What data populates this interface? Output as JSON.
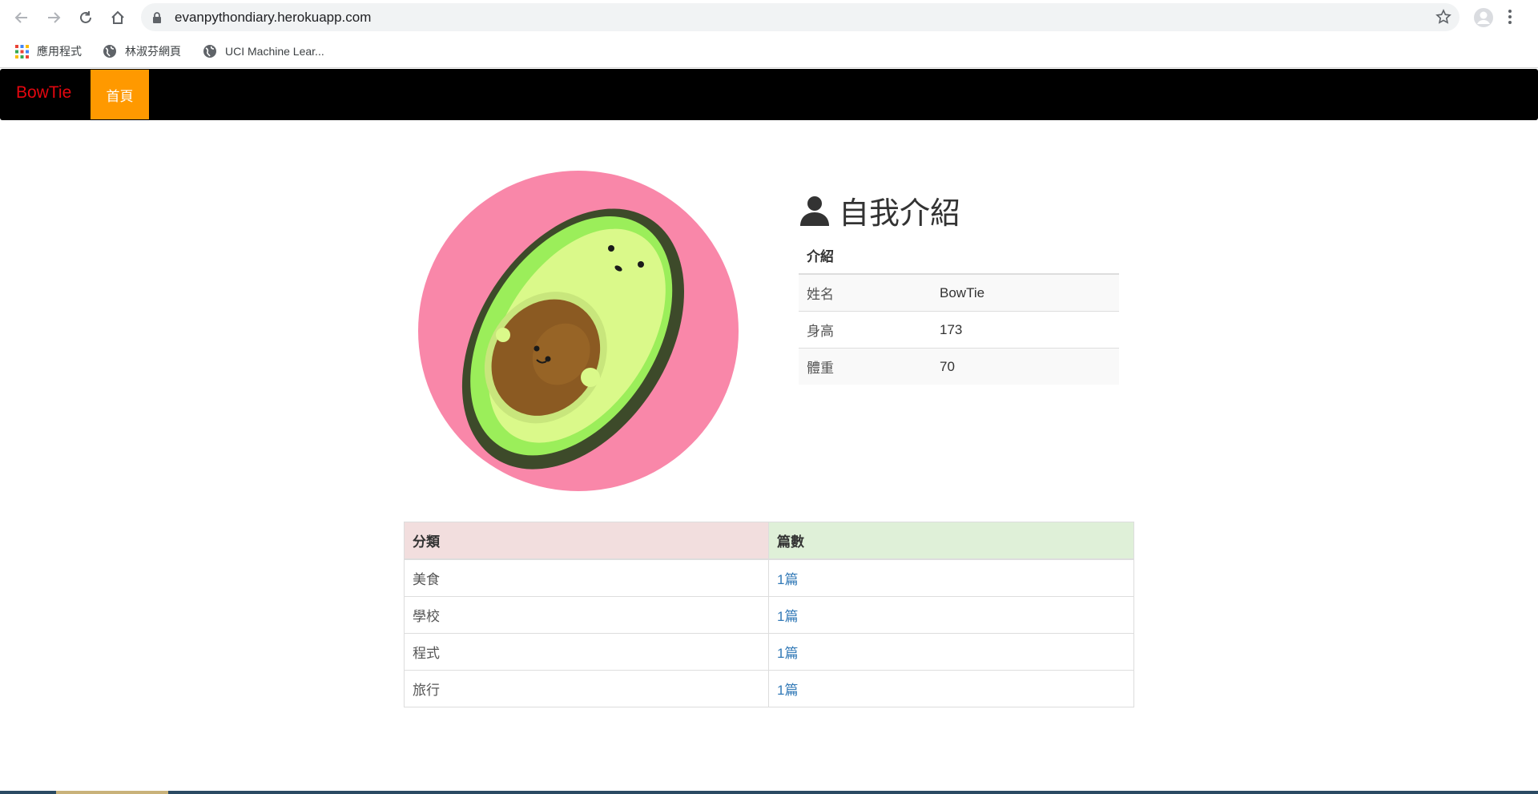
{
  "browser": {
    "url": "evanpythondiary.herokuapp.com",
    "bookmarks": [
      {
        "label": "應用程式",
        "icon": "apps-grid-icon"
      },
      {
        "label": "林淑芬網頁",
        "icon": "globe-icon"
      },
      {
        "label": "UCI Machine Lear...",
        "icon": "globe-icon"
      }
    ]
  },
  "navbar": {
    "brand": "BowTie",
    "home": "首頁",
    "colors": {
      "background": "#000000",
      "brand": "#e4060f",
      "active": "#ff9900"
    }
  },
  "profile": {
    "title": "自我介紹",
    "table_header": "介紹",
    "rows": [
      {
        "label": "姓名",
        "value": "BowTie"
      },
      {
        "label": "身高",
        "value": "173"
      },
      {
        "label": "體重",
        "value": "70"
      }
    ]
  },
  "categories": {
    "headers": [
      "分類",
      "篇數"
    ],
    "rows": [
      {
        "name": "美食",
        "count": "1篇"
      },
      {
        "name": "學校",
        "count": "1篇"
      },
      {
        "name": "程式",
        "count": "1篇"
      },
      {
        "name": "旅行",
        "count": "1篇"
      }
    ]
  }
}
